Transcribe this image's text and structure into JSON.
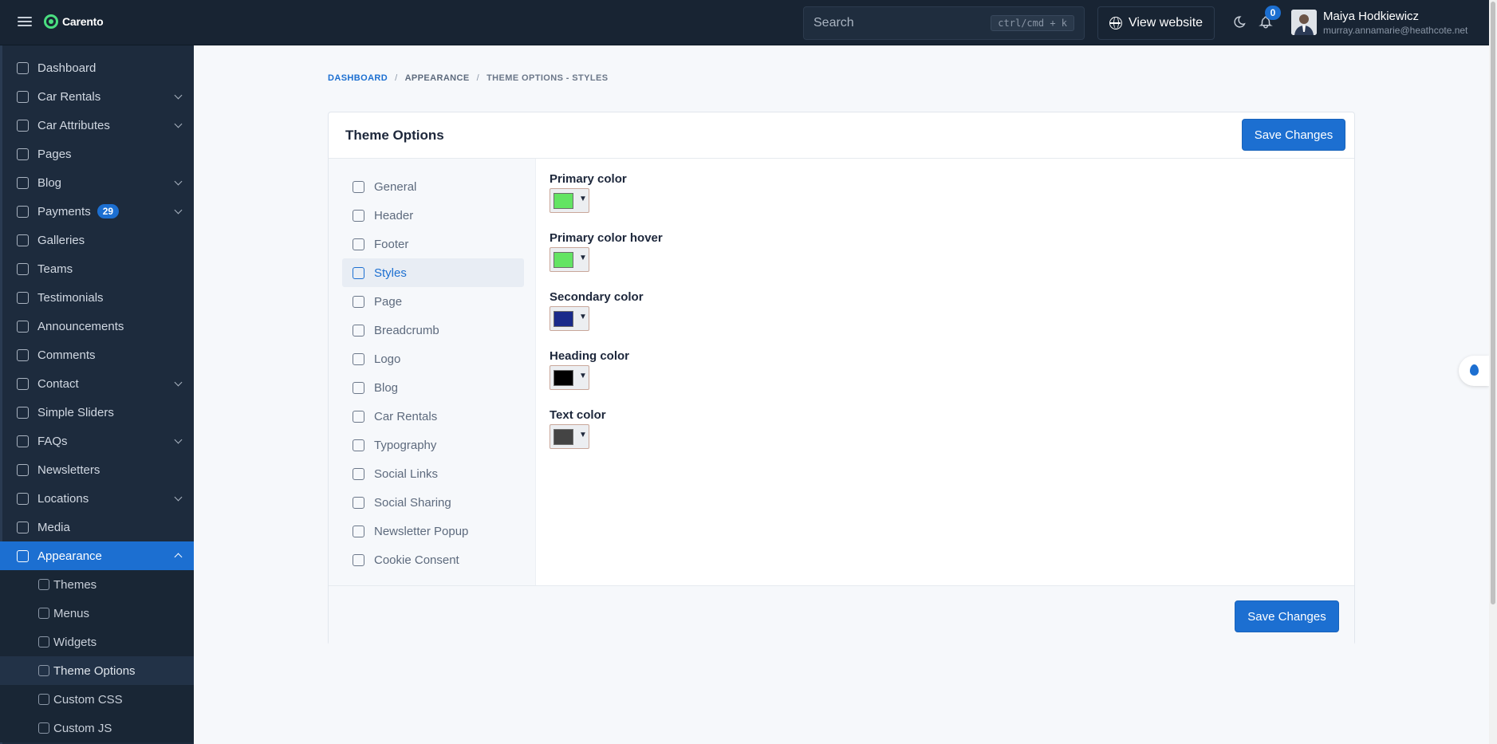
{
  "app": {
    "name": "Carento"
  },
  "header": {
    "search_placeholder": "Search",
    "search_shortcut": "ctrl/cmd + k",
    "view_website": "View website",
    "notifications_count": "0",
    "user": {
      "name": "Maiya Hodkiewicz",
      "email": "murray.annamarie@heathcote.net"
    }
  },
  "sidebar": {
    "items": [
      {
        "label": "Dashboard",
        "icon": "home-icon",
        "has_children": false
      },
      {
        "label": "Car Rentals",
        "icon": "car-icon",
        "has_children": true
      },
      {
        "label": "Car Attributes",
        "icon": "layout-icon",
        "has_children": true
      },
      {
        "label": "Pages",
        "icon": "notebook-icon",
        "has_children": false
      },
      {
        "label": "Blog",
        "icon": "article-icon",
        "has_children": true
      },
      {
        "label": "Payments",
        "icon": "credit-card-icon",
        "has_children": true,
        "badge": "29"
      },
      {
        "label": "Galleries",
        "icon": "camera-icon",
        "has_children": false
      },
      {
        "label": "Teams",
        "icon": "users-icon",
        "has_children": false
      },
      {
        "label": "Testimonials",
        "icon": "user-star-icon",
        "has_children": false
      },
      {
        "label": "Announcements",
        "icon": "speakerphone-icon",
        "has_children": false
      },
      {
        "label": "Comments",
        "icon": "messages-icon",
        "has_children": false
      },
      {
        "label": "Contact",
        "icon": "mail-icon",
        "has_children": true
      },
      {
        "label": "Simple Sliders",
        "icon": "slideshow-icon",
        "has_children": false
      },
      {
        "label": "FAQs",
        "icon": "help-circle-icon",
        "has_children": true
      },
      {
        "label": "Newsletters",
        "icon": "mail-icon",
        "has_children": false
      },
      {
        "label": "Locations",
        "icon": "world-icon",
        "has_children": true
      },
      {
        "label": "Media",
        "icon": "folder-icon",
        "has_children": false
      },
      {
        "label": "Appearance",
        "icon": "brush-icon",
        "has_children": true,
        "active": true
      }
    ],
    "appearance_children": [
      {
        "label": "Themes",
        "icon": "palette-icon"
      },
      {
        "label": "Menus",
        "icon": "sitemap-icon"
      },
      {
        "label": "Widgets",
        "icon": "layout-icon"
      },
      {
        "label": "Theme Options",
        "icon": "list-details-icon",
        "current": true
      },
      {
        "label": "Custom CSS",
        "icon": "file-css-icon"
      },
      {
        "label": "Custom JS",
        "icon": "file-js-icon"
      }
    ]
  },
  "breadcrumb": {
    "home": "DASHBOARD",
    "parent": "APPEARANCE",
    "current": "THEME OPTIONS - STYLES",
    "separator": "/"
  },
  "panel": {
    "title": "Theme Options",
    "save_label": "Save Changes",
    "tabs": [
      {
        "label": "General",
        "icon": "home-icon"
      },
      {
        "label": "Header",
        "icon": "browser-icon"
      },
      {
        "label": "Footer",
        "icon": "layout-bottombar-icon"
      },
      {
        "label": "Styles",
        "icon": "brush-icon",
        "selected": true
      },
      {
        "label": "Page",
        "icon": "book-icon"
      },
      {
        "label": "Breadcrumb",
        "icon": "directions-icon"
      },
      {
        "label": "Logo",
        "icon": "photo-icon"
      },
      {
        "label": "Blog",
        "icon": "edit-icon"
      },
      {
        "label": "Car Rentals",
        "icon": "car-icon"
      },
      {
        "label": "Typography",
        "icon": "typography-icon"
      },
      {
        "label": "Social Links",
        "icon": "social-icon"
      },
      {
        "label": "Social Sharing",
        "icon": "share-icon"
      },
      {
        "label": "Newsletter Popup",
        "icon": "mail-opened-icon"
      },
      {
        "label": "Cookie Consent",
        "icon": "cookie-icon"
      }
    ],
    "fields": [
      {
        "label": "Primary color",
        "color": "#63e463"
      },
      {
        "label": "Primary color hover",
        "color": "#63e463"
      },
      {
        "label": "Secondary color",
        "color": "#1a2a8a"
      },
      {
        "label": "Heading color",
        "color": "#000000"
      },
      {
        "label": "Text color",
        "color": "#444444"
      }
    ]
  },
  "colors": {
    "accent": "#1c6fd1",
    "sidebar_bg": "#1d2b3d",
    "header_bg": "#182433"
  }
}
